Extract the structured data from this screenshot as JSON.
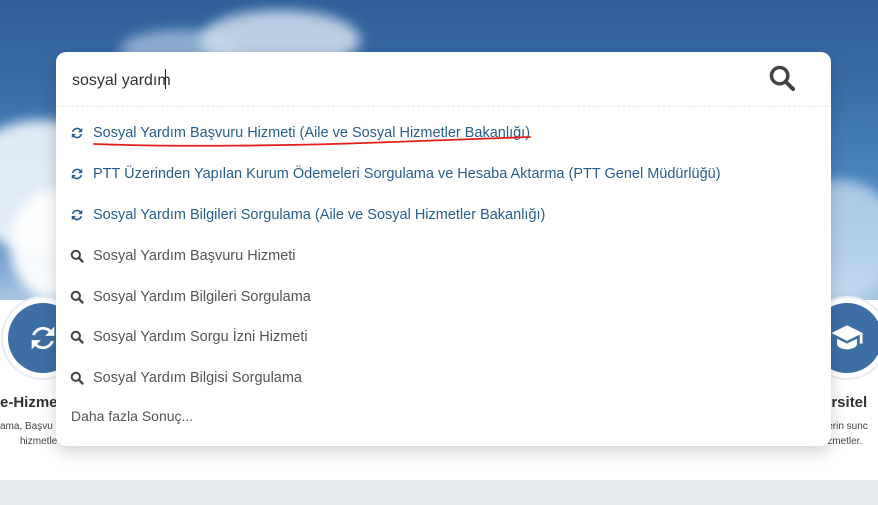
{
  "search": {
    "value": "sosyal yardım",
    "icon": "search-icon"
  },
  "results": [
    {
      "type": "service",
      "icon": "refresh-icon",
      "label": "Sosyal Yardım Başvuru Hizmeti (Aile ve Sosyal Hizmetler Bakanlığı)"
    },
    {
      "type": "service",
      "icon": "refresh-icon",
      "label": "PTT Üzerinden Yapılan Kurum Ödemeleri Sorgulama ve Hesaba Aktarma (PTT Genel Müdürlüğü)"
    },
    {
      "type": "service",
      "icon": "refresh-icon",
      "label": "Sosyal Yardım Bilgileri Sorgulama (Aile ve Sosyal Hizmetler Bakanlığı)"
    },
    {
      "type": "query",
      "icon": "search-icon",
      "label": "Sosyal Yardım Başvuru Hizmeti"
    },
    {
      "type": "query",
      "icon": "search-icon",
      "label": "Sosyal Yardım Bilgileri Sorgulama"
    },
    {
      "type": "query",
      "icon": "search-icon",
      "label": "Sosyal Yardım Sorgu İzni Hizmeti"
    },
    {
      "type": "query",
      "icon": "search-icon",
      "label": "Sosyal Yardım Bilgisi Sorgulama"
    }
  ],
  "more_label": "Daha fazla Sonuç...",
  "left_card": {
    "title": "e-Hizme",
    "desc_line1": "ama, Başvu",
    "desc_line2": "hizmetle"
  },
  "right_card": {
    "title": "ersitel",
    "desc_line1": "lerin sunc",
    "desc_line2": "izmetler."
  },
  "colors": {
    "service_link": "#2a5d8f",
    "query_text": "#555555",
    "accent": "#3d6fa5",
    "annotation": "#e0201a"
  }
}
